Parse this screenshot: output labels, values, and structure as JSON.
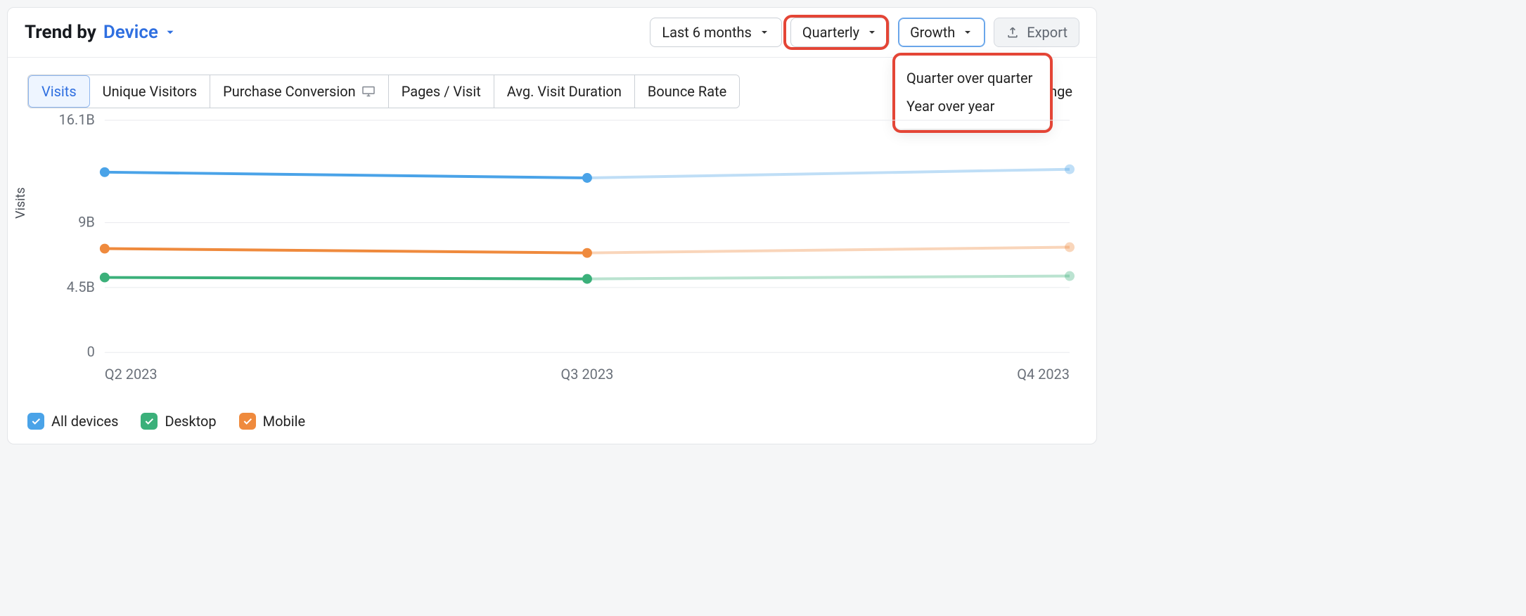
{
  "header": {
    "title_static": "Trend by",
    "title_link": "Device"
  },
  "controls": {
    "range_label": "Last 6 months",
    "interval_label": "Quarterly",
    "growth_label": "Growth",
    "export_label": "Export"
  },
  "growth_options": {
    "opt1": "Quarter over quarter",
    "opt2": "Year over year"
  },
  "tabs": {
    "t1": "Visits",
    "t2": "Unique Visitors",
    "t3": "Purchase Conversion",
    "t4": "Pages / Visit",
    "t5": "Avg. Visit Duration",
    "t6": "Bounce Rate"
  },
  "right_hint": "ange",
  "yaxis_label": "Visits",
  "yticks": {
    "t0": "0",
    "t1": "4.5B",
    "t2": "9B",
    "t3": "16.1B"
  },
  "xticks": {
    "x0": "Q2 2023",
    "x1": "Q3 2023",
    "x2": "Q4 2023"
  },
  "legend": {
    "l1": "All devices",
    "l2": "Desktop",
    "l3": "Mobile"
  },
  "colors": {
    "all": "#4aa3e8",
    "desktop": "#3bb07a",
    "mobile": "#ef8a3d",
    "all_faded": "#a4d3f6",
    "desktop_faded": "#aee0c9",
    "mobile_faded": "#f7cfab",
    "highlight_red": "#e44536",
    "accent_blue": "#2f6fe0"
  },
  "chart_data": {
    "type": "line",
    "title": "Trend by Device — Visits",
    "xlabel": "",
    "ylabel": "Visits",
    "yticks": [
      0,
      4.5,
      9,
      16.1
    ],
    "ylim": [
      0,
      16.1
    ],
    "unit": "B",
    "categories": [
      "Q2 2023",
      "Q3 2023",
      "Q4 2023"
    ],
    "solid_segments": "Q2→Q3 solid, Q3→Q4 faded (projection)",
    "series": [
      {
        "name": "All devices",
        "color": "#4aa3e8",
        "values": [
          12.5,
          12.1,
          12.7
        ]
      },
      {
        "name": "Mobile",
        "color": "#ef8a3d",
        "values": [
          7.2,
          6.9,
          7.3
        ]
      },
      {
        "name": "Desktop",
        "color": "#3bb07a",
        "values": [
          5.2,
          5.1,
          5.3
        ]
      }
    ]
  }
}
